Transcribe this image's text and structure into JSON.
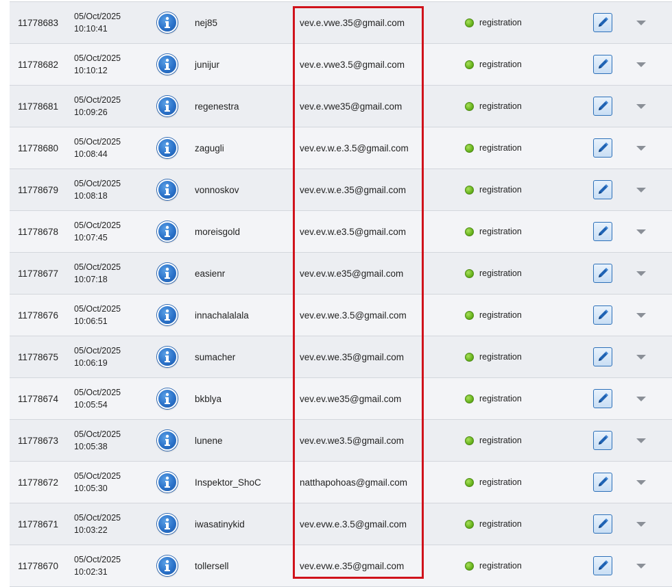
{
  "rows": [
    {
      "id": "11778683",
      "date": "05/Oct/2025",
      "time": "10:10:41",
      "username": "nej85",
      "email": "vev.e.vwe.35@gmail.com",
      "status": "registration"
    },
    {
      "id": "11778682",
      "date": "05/Oct/2025",
      "time": "10:10:12",
      "username": "junijur",
      "email": "vev.e.vwe3.5@gmail.com",
      "status": "registration"
    },
    {
      "id": "11778681",
      "date": "05/Oct/2025",
      "time": "10:09:26",
      "username": "regenestra",
      "email": "vev.e.vwe35@gmail.com",
      "status": "registration"
    },
    {
      "id": "11778680",
      "date": "05/Oct/2025",
      "time": "10:08:44",
      "username": "zagugli",
      "email": "vev.ev.w.e.3.5@gmail.com",
      "status": "registration"
    },
    {
      "id": "11778679",
      "date": "05/Oct/2025",
      "time": "10:08:18",
      "username": "vonnoskov",
      "email": "vev.ev.w.e.35@gmail.com",
      "status": "registration"
    },
    {
      "id": "11778678",
      "date": "05/Oct/2025",
      "time": "10:07:45",
      "username": "moreisgold",
      "email": "vev.ev.w.e3.5@gmail.com",
      "status": "registration"
    },
    {
      "id": "11778677",
      "date": "05/Oct/2025",
      "time": "10:07:18",
      "username": "easienr",
      "email": "vev.ev.w.e35@gmail.com",
      "status": "registration"
    },
    {
      "id": "11778676",
      "date": "05/Oct/2025",
      "time": "10:06:51",
      "username": "innachalalala",
      "email": "vev.ev.we.3.5@gmail.com",
      "status": "registration"
    },
    {
      "id": "11778675",
      "date": "05/Oct/2025",
      "time": "10:06:19",
      "username": "sumacher",
      "email": "vev.ev.we.35@gmail.com",
      "status": "registration"
    },
    {
      "id": "11778674",
      "date": "05/Oct/2025",
      "time": "10:05:54",
      "username": "bkblya",
      "email": "vev.ev.we35@gmail.com",
      "status": "registration"
    },
    {
      "id": "11778673",
      "date": "05/Oct/2025",
      "time": "10:05:38",
      "username": "lunene",
      "email": "vev.ev.we3.5@gmail.com",
      "status": "registration"
    },
    {
      "id": "11778672",
      "date": "05/Oct/2025",
      "time": "10:05:30",
      "username": "Inspektor_ShoC",
      "email": "natthapohoas@gmail.com",
      "status": "registration"
    },
    {
      "id": "11778671",
      "date": "05/Oct/2025",
      "time": "10:03:22",
      "username": "iwasatinykid",
      "email": "vev.evw.e.3.5@gmail.com",
      "status": "registration"
    },
    {
      "id": "11778670",
      "date": "05/Oct/2025",
      "time": "10:02:31",
      "username": "tollersell",
      "email": "vev.evw.e.35@gmail.com",
      "status": "registration"
    }
  ],
  "icons": {
    "info": "info-icon",
    "status": "status-dot",
    "edit": "pencil-icon",
    "more": "chevron-down-icon"
  },
  "colors": {
    "highlight_border": "#d0121b",
    "info_blue": "#2b72c9",
    "status_green": "#6ab51f",
    "row_odd": "#eceef2",
    "row_even": "#f3f4f7"
  }
}
